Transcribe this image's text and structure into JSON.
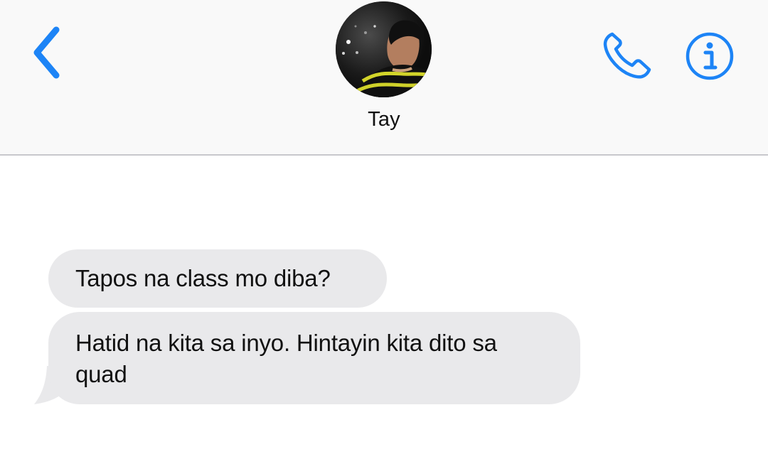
{
  "header": {
    "back_icon": "chevron-left-icon",
    "contact_name": "Tay",
    "call_icon": "phone-icon",
    "info_icon": "info-icon",
    "accent_color": "#1d84f6"
  },
  "messages": [
    {
      "direction": "incoming",
      "text": "Tapos na class mo diba?"
    },
    {
      "direction": "incoming",
      "text": "Hatid na kita sa inyo. Hintayin kita dito sa quad"
    }
  ],
  "colors": {
    "incoming_bubble": "#e9e9eb",
    "header_background": "#f9f9f9",
    "divider": "#c8c8cc"
  }
}
